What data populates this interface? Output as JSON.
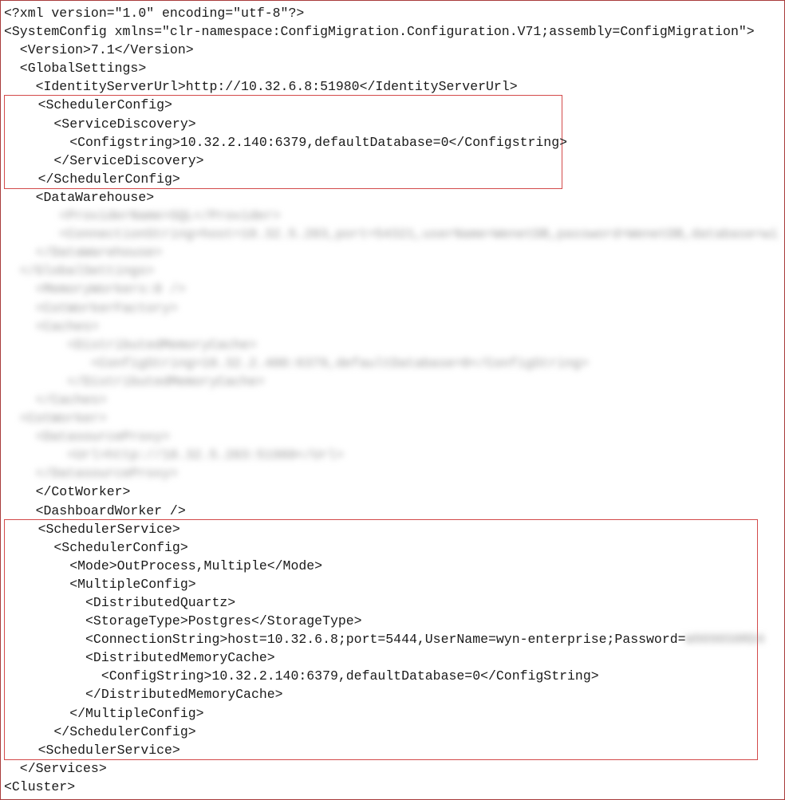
{
  "xml": {
    "declaration": "<?xml version=\"1.0\" encoding=\"utf-8\"?>",
    "systemConfigOpen": "<SystemConfig xmlns=\"clr-namespace:ConfigMigration.Configuration.V71;assembly=ConfigMigration\">",
    "versionLine": "  <Version>7.1</Version>",
    "globalSettingsOpen": "  <GlobalSettings>",
    "identityServerUrl": "    <IdentityServerUrl>http://10.32.6.8:51980</IdentityServerUrl>",
    "box1": {
      "schedulerConfigOpen": "    <SchedulerConfig>",
      "serviceDiscoveryOpen": "      <ServiceDiscovery>",
      "configstring": "        <Configstring>10.32.2.140:6379,defaultDatabase=0</Configstring>",
      "serviceDiscoveryClose": "      </ServiceDiscovery>",
      "schedulerConfigClose": "    </SchedulerConfig>"
    },
    "dataWarehouseOpen": "    <DataWarehouse>",
    "blurred1": "       <ProviderName>SQL</Provider>",
    "blurred2": "       <ConnectionString>host=10.32.5.203,port=54321,userName=WenetDB,password=WenetDB,database=wi",
    "blurred3": "    </DataWarehouse>",
    "blurred4": "  </GlobalSettings>",
    "blurred5": "    <MemoryWorkers:0 />",
    "blurred6": "    <CotWorkerFactory>",
    "blurred7": "    <Caches>",
    "blurred8": "        <DistributedMemoryCache>",
    "blurred9": "           <ConfigString>10.32.2.400:6379,defaultDatabase=0</ConfigString>",
    "blurred10": "        </DistributedMemoryCache>",
    "blurred11": "    </Caches>",
    "blurred12": "  <CotWorker>",
    "blurred13": "    <DatasourceProxy>",
    "blurred14": "        <Url>http://10.32.5.203:51980</Url>",
    "blurred15": "    </DatasourceProxy>",
    "cotWorkerClose": "    </CotWorker>",
    "dashboardWorker": "    <DashboardWorker />",
    "box2": {
      "schedulerServiceOpen": "    <SchedulerService>",
      "schedulerConfigOpen": "      <SchedulerConfig>",
      "modeLine": "        <Mode>OutProcess,Multiple</Mode>",
      "multipleConfigOpen": "        <MultipleConfig>",
      "distributedQuartz": "          <DistributedQuartz>",
      "storageType": "          <StorageType>Postgres</StorageType>",
      "connectionStringPrefix": "          <ConnectionString>host=10.32.6.8;port=5444,UserName=wyn-enterprise;Password=",
      "connectionStringBlur": "W9090S0RD4",
      "distributedMemoryCacheOpen": "          <DistributedMemoryCache>",
      "configString": "            <ConfigString>10.32.2.140:6379,defaultDatabase=0</ConfigString>",
      "distributedMemoryCacheClose": "          </DistributedMemoryCache>",
      "multipleConfigClose": "        </MultipleConfig>",
      "schedulerConfigClose": "      </SchedulerConfig>",
      "schedulerServiceClose": "    <SchedulerService>"
    },
    "servicesClose": "  </Services>",
    "clusterOpen": "<Cluster>"
  }
}
